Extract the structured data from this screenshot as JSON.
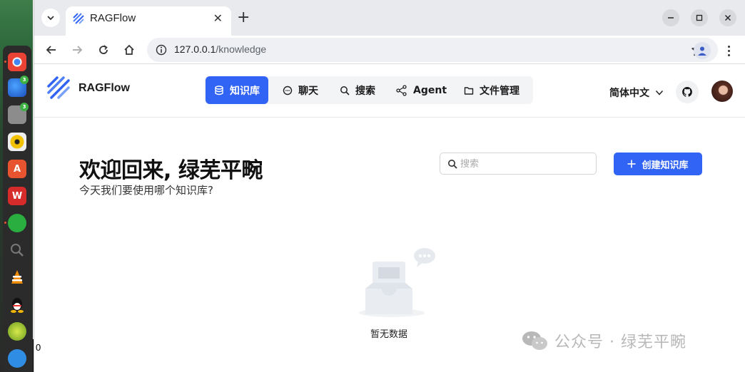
{
  "desktop": {
    "dock_items": [
      {
        "icon": "chrome-icon",
        "badge": ""
      },
      {
        "icon": "thunderbird-icon",
        "badge": "3"
      },
      {
        "icon": "files-icon",
        "badge": "3"
      },
      {
        "icon": "rhythmbox-icon",
        "badge": ""
      },
      {
        "icon": "app-store-icon",
        "badge": ""
      },
      {
        "icon": "wps-office-icon",
        "badge": ""
      },
      {
        "icon": "wechat-icon",
        "badge": ""
      },
      {
        "icon": "magnifier-icon",
        "badge": ""
      },
      {
        "icon": "vlc-icon",
        "badge": ""
      },
      {
        "icon": "qq-icon",
        "badge": ""
      },
      {
        "icon": "app-green-icon",
        "badge": ""
      },
      {
        "icon": "feishu-icon",
        "badge": ""
      }
    ],
    "stray_text": "0"
  },
  "browser": {
    "tab_title": "RAGFlow",
    "new_tab_label": "+",
    "url_host": "127.0.0.1",
    "url_path": "/knowledge"
  },
  "app": {
    "brand": "RAGFlow",
    "nav": [
      {
        "label": "知识库",
        "icon": "database-icon",
        "active": true
      },
      {
        "label": "聊天",
        "icon": "chat-bubble-icon",
        "active": false
      },
      {
        "label": "搜索",
        "icon": "search-icon",
        "active": false
      },
      {
        "label": "Agent",
        "icon": "agent-graph-icon",
        "active": false
      },
      {
        "label": "文件管理",
        "icon": "folder-icon",
        "active": false
      }
    ],
    "language": "简体中文",
    "accent": "#3164f4"
  },
  "page": {
    "welcome": "欢迎回来, 绿芜平畹",
    "subtitle": "今天我们要使用哪个知识库?",
    "search_placeholder": "搜索",
    "create_label": "创建知识库",
    "empty_text": "暂无数据"
  },
  "watermark": {
    "text": "公众号 · 绿芜平畹"
  }
}
